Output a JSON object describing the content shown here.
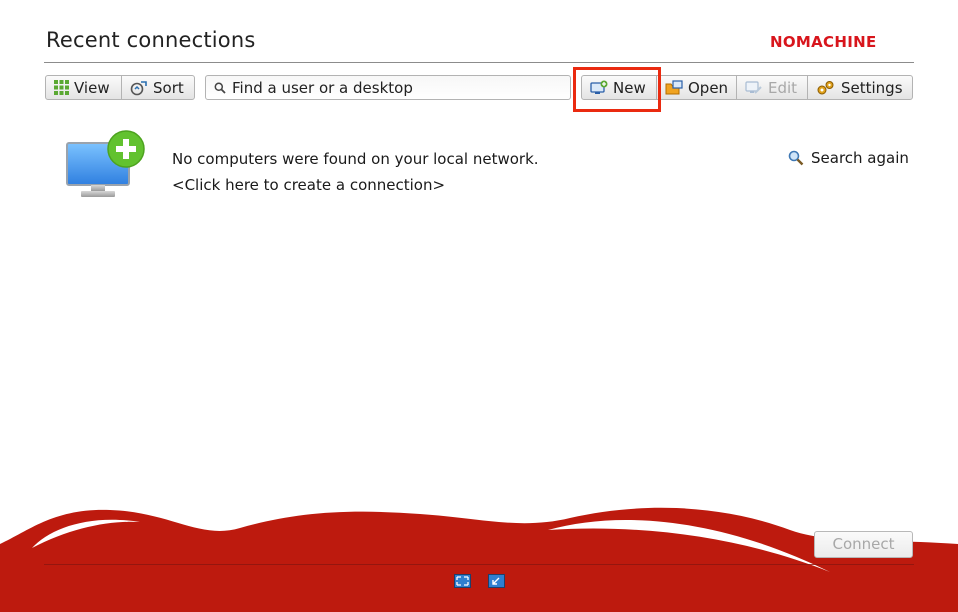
{
  "header": {
    "title": "Recent connections",
    "brand": "NOMACHINE",
    "brand_color": "#d8151c"
  },
  "toolbar": {
    "view_label": "View",
    "sort_label": "Sort",
    "search_placeholder": "Find a user or a desktop",
    "new_label": "New",
    "open_label": "Open",
    "edit_label": "Edit",
    "settings_label": "Settings",
    "edit_enabled": false,
    "highlight_color": "#ea2a10"
  },
  "main": {
    "empty_message": "No computers were found on your local network.",
    "create_link": "<Click here to create a connection>",
    "search_again_label": "Search again"
  },
  "footer": {
    "connect_label": "Connect",
    "connect_enabled": false,
    "background_color": "#bd1a0e",
    "icons": [
      "fullscreen-icon",
      "minimize-icon"
    ]
  }
}
